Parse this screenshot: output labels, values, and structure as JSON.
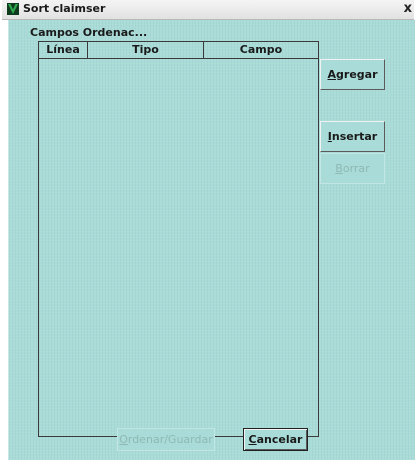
{
  "window": {
    "title": "Sort claimser",
    "close_glyph": "x",
    "icon": "app-logo-icon"
  },
  "dialog": {
    "section_label": "Campos Ordenac...",
    "table": {
      "columns": [
        "Línea",
        "Tipo",
        "Campo"
      ],
      "rows": []
    },
    "side_buttons": {
      "agregar": {
        "mnemonic": "A",
        "rest": "gregar",
        "enabled": true
      },
      "insertar": {
        "mnemonic": "I",
        "rest": "nsertar",
        "enabled": true
      },
      "borrar": {
        "mnemonic": "B",
        "rest": "orrar",
        "enabled": false
      }
    },
    "bottom_buttons": {
      "ordenar": {
        "mnemonic": "O",
        "rest": "rdenar/Guardar",
        "enabled": false
      },
      "cancelar": {
        "mnemonic": "C",
        "rest": "ancelar",
        "enabled": true
      }
    }
  },
  "colors": {
    "dialog_bg": "#a9dcd8",
    "disabled_text": "#8fb8b4",
    "icon_green": "#1f8a3a"
  }
}
